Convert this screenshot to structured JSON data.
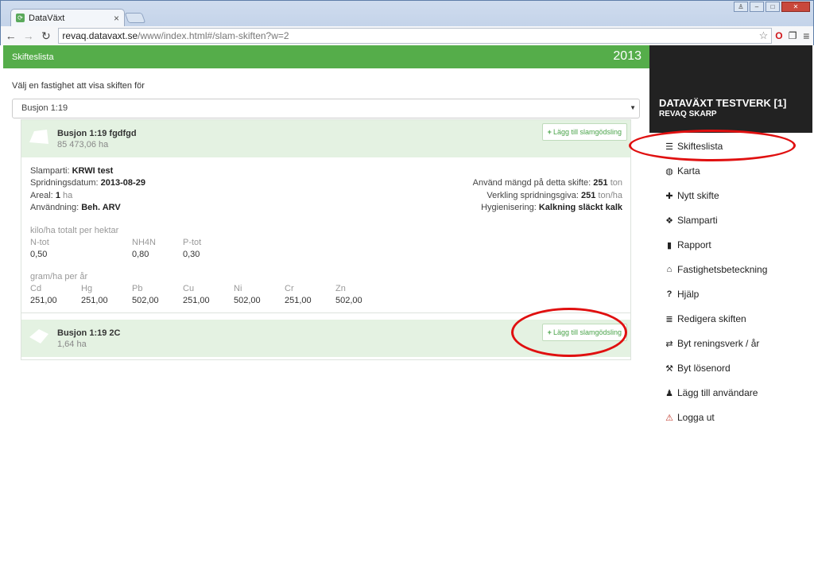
{
  "browser": {
    "tab_title": "DataVäxt",
    "url_host": "revaq.datavaxt.se",
    "url_path": "/www/index.html#/slam-skiften?w=2"
  },
  "header": {
    "title": "Skifteslista",
    "year": "2013"
  },
  "filter": {
    "label": "Välj en fastighet att visa skiften för",
    "selected": "Busjon 1:19"
  },
  "add_label": "Lägg till slamgödsling",
  "fields": [
    {
      "name": "Busjon 1:19 fgdfgd",
      "area": "85 473,06 ha"
    },
    {
      "name": "Busjon 1:19 2C",
      "area": "1,64 ha"
    }
  ],
  "details": {
    "slamparti_label": "Slamparti:",
    "slamparti_value": "KRWI test",
    "date_label": "Spridningsdatum:",
    "date_value": "2013-08-29",
    "areal_label": "Areal:",
    "areal_value": "1",
    "areal_unit": "ha",
    "use_label": "Användning:",
    "use_value": "Beh. ARV",
    "used_label": "Använd mängd på detta skifte:",
    "used_value": "251",
    "used_unit": "ton",
    "dose_label": "Verkling spridningsgiva:",
    "dose_value": "251",
    "dose_unit": "ton/ha",
    "hyg_label": "Hygienisering:",
    "hyg_value": "Kalkning släckt kalk",
    "nutrient_title": "kilo/ha totalt per hektar",
    "nutrients": [
      {
        "label": "N-tot",
        "value": "0,50"
      },
      {
        "label": "NH4N",
        "value": "0,80"
      },
      {
        "label": "P-tot",
        "value": "0,30"
      }
    ],
    "metal_title": "gram/ha per år",
    "metals": [
      {
        "label": "Cd",
        "value": "251,00"
      },
      {
        "label": "Hg",
        "value": "251,00"
      },
      {
        "label": "Pb",
        "value": "502,00"
      },
      {
        "label": "Cu",
        "value": "251,00"
      },
      {
        "label": "Ni",
        "value": "502,00"
      },
      {
        "label": "Cr",
        "value": "251,00"
      },
      {
        "label": "Zn",
        "value": "502,00"
      }
    ]
  },
  "sidebar": {
    "org": "DATAVÄXT TESTVERK [1]",
    "user": "REVAQ SKARP",
    "items": [
      {
        "label": "Skifteslista",
        "icon": "list-icon"
      },
      {
        "label": "Karta",
        "icon": "globe-icon"
      },
      {
        "label": "Nytt skifte",
        "icon": "plus-icon"
      },
      {
        "label": "Slamparti",
        "icon": "cubes-icon"
      },
      {
        "label": "Rapport",
        "icon": "file-icon"
      },
      {
        "label": "Fastighetsbeteckning",
        "icon": "home-icon"
      },
      {
        "label": "Hjälp",
        "icon": "question-icon"
      },
      {
        "label": "Redigera skiften",
        "icon": "tasks-icon"
      },
      {
        "label": "Byt reningsverk / år",
        "icon": "swap-icon"
      },
      {
        "label": "Byt lösenord",
        "icon": "wrench-icon"
      },
      {
        "label": "Lägg till användare",
        "icon": "user-icon"
      },
      {
        "label": "Logga ut",
        "icon": "warning-icon"
      }
    ]
  },
  "colors": {
    "header_green": "#55ad4a",
    "field_bg": "#e4f2e2",
    "sidebar_dark": "#222222",
    "annotation_red": "#e01010"
  }
}
